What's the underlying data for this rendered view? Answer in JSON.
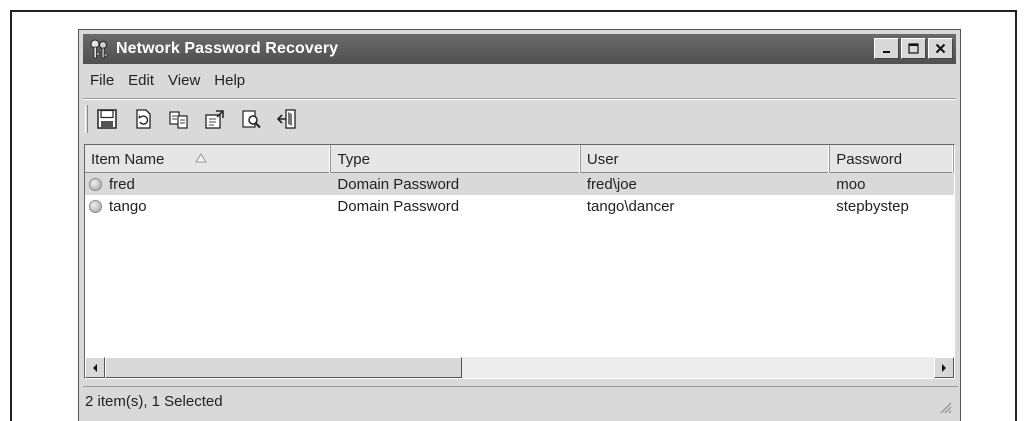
{
  "window": {
    "title": "Network Password Recovery",
    "icon": "keys-icon"
  },
  "window_controls": {
    "minimize": "minimize-icon",
    "maximize": "maximize-icon",
    "close": "close-icon"
  },
  "menu": [
    "File",
    "Edit",
    "View",
    "Help"
  ],
  "toolbar": [
    "save-icon",
    "refresh-icon",
    "copy-icon",
    "properties-icon",
    "find-icon",
    "exit-icon"
  ],
  "table": {
    "columns": [
      "Item Name",
      "Type",
      "User",
      "Password"
    ],
    "sort_column": "Item Name",
    "rows": [
      {
        "name": "fred",
        "type": "Domain Password",
        "user": "fred\\joe",
        "password": "moo",
        "selected": true
      },
      {
        "name": "tango",
        "type": "Domain Password",
        "user": "tango\\dancer",
        "password": "stepbystep",
        "selected": false
      }
    ]
  },
  "status": "2 item(s), 1 Selected",
  "colors": {
    "title_bar": "#5c5c5c",
    "window_bg": "#d9d9d9",
    "selected_row": "#d9d9d9"
  }
}
